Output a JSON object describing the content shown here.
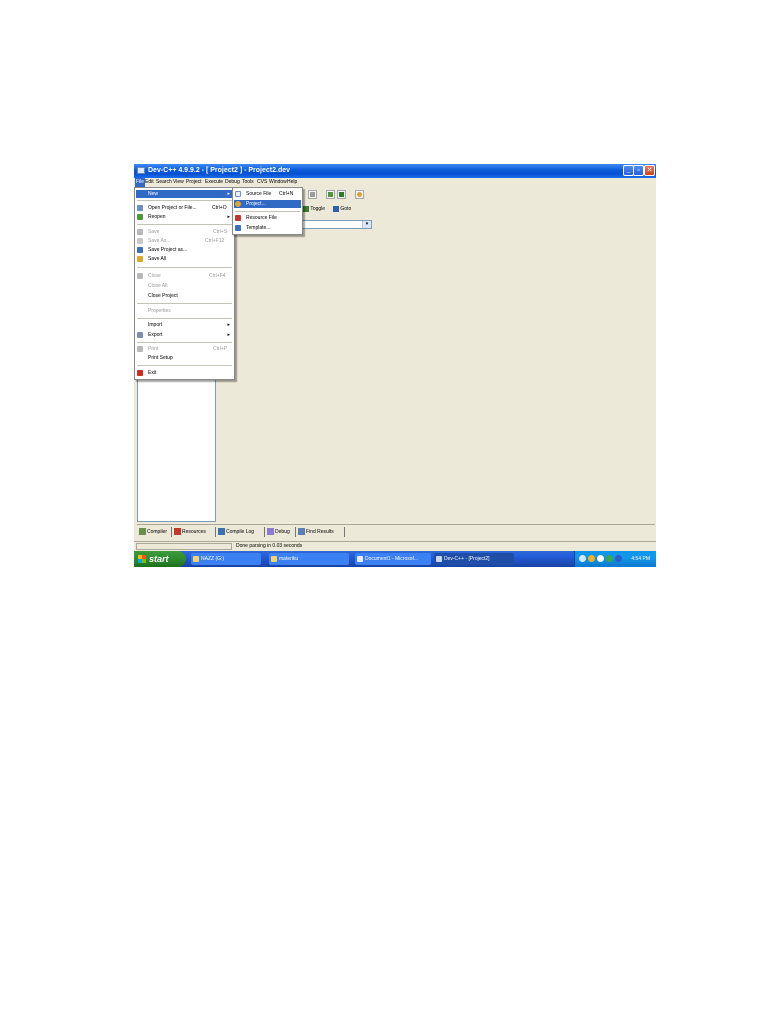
{
  "window": {
    "title": "Dev-C++ 4.9.9.2  - [ Project2 ] - Project2.dev",
    "minimize_glyph": "_",
    "maximize_glyph": "▫",
    "close_glyph": "✕"
  },
  "menubar": {
    "items": [
      "File",
      "Edit",
      "Search",
      "View",
      "Project",
      "Execute",
      "Debug",
      "Tools",
      "CVS",
      "Window",
      "Help"
    ]
  },
  "toolbar": {
    "toggle_label": "Toggle",
    "goto_label": "Goto"
  },
  "file_menu": {
    "new": {
      "label": "New"
    },
    "open": {
      "label": "Open Project or File...",
      "shortcut": "Ctrl+O"
    },
    "reopen": {
      "label": "Reopen"
    },
    "save": {
      "label": "Save",
      "shortcut": "Ctrl+S"
    },
    "save_as": {
      "label": "Save As...",
      "shortcut": "Ctrl+F12"
    },
    "save_project_as": {
      "label": "Save Project as..."
    },
    "save_all": {
      "label": "Save All"
    },
    "close": {
      "label": "Close",
      "shortcut": "Ctrl+F4"
    },
    "close_all": {
      "label": "Close All"
    },
    "close_project": {
      "label": "Close Project"
    },
    "properties": {
      "label": "Properties"
    },
    "import": {
      "label": "Import"
    },
    "export": {
      "label": "Export"
    },
    "print": {
      "label": "Print",
      "shortcut": "Ctrl+P"
    },
    "print_setup": {
      "label": "Print Setup"
    },
    "exit": {
      "label": "Exit"
    },
    "submenu_arrow": "▸"
  },
  "new_submenu": {
    "source_file": {
      "label": "Source File",
      "shortcut": "Ctrl+N"
    },
    "project": {
      "label": "Project..."
    },
    "resource_file": {
      "label": "Resource File"
    },
    "template": {
      "label": "Template..."
    }
  },
  "bottom_tabs": {
    "compiler": "Compiler",
    "resources": "Resources",
    "compile_log": "Compile Log",
    "debug": "Debug",
    "find_results": "Find Results"
  },
  "statusbar": {
    "text": "Done parsing in 0.03 seconds"
  },
  "taskbar": {
    "start_label": "start",
    "tasks": [
      "NAZZ (G:)",
      "materiku",
      "Document1 - Microsof...",
      "Dev-C++ - [Project2]"
    ],
    "clock": "4:54 PM"
  },
  "colors": {
    "titlebar": "#0a5ad8",
    "selection": "#316ac5",
    "window_bg": "#ece9d8",
    "start_button": "#2f8b2f"
  }
}
